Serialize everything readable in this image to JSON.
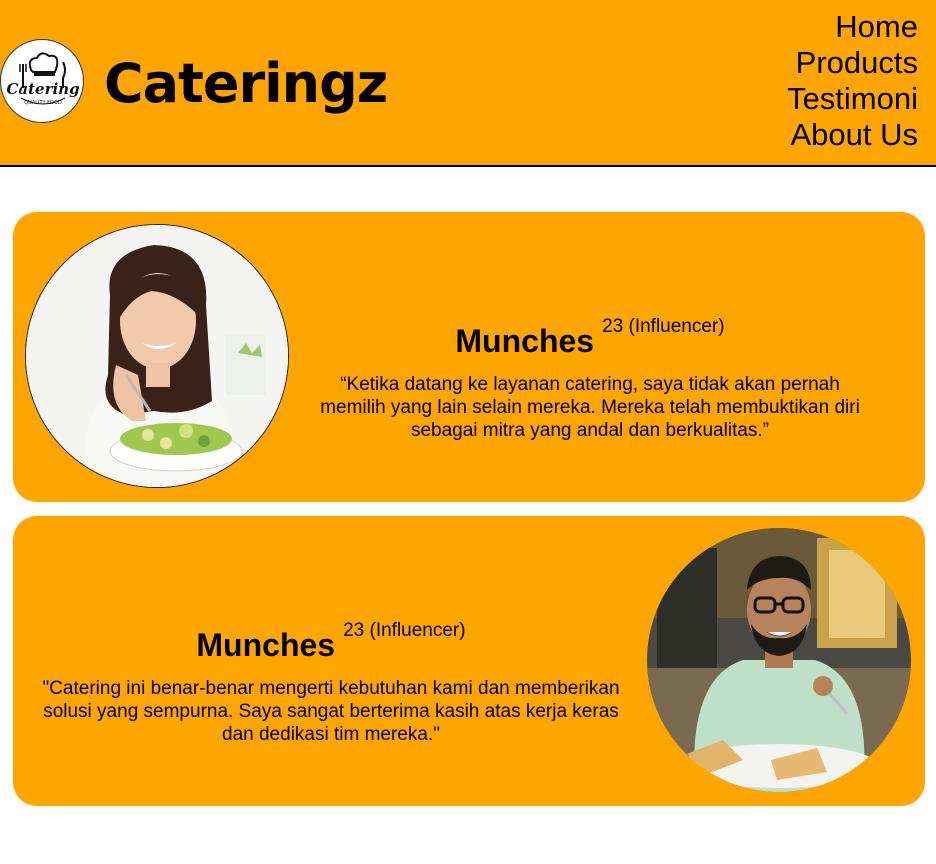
{
  "header": {
    "logo": {
      "text": "Catering",
      "subtext": "QUALITY FOOD",
      "icon": "chef-hat-icon"
    },
    "brand": "Cateringz",
    "nav": [
      {
        "label": "Home"
      },
      {
        "label": "Products"
      },
      {
        "label": "Testimoni"
      },
      {
        "label": "About Us"
      }
    ]
  },
  "testimonials": [
    {
      "name": "Munches",
      "meta": "23 (Influencer)",
      "quote": "“Ketika datang ke layanan catering, saya tidak akan pernah memilih yang lain selain mereka. Mereka telah membuktikan diri sebagai mitra yang andal dan berkualitas.”",
      "photo": "woman-eating-salad"
    },
    {
      "name": "Munches",
      "meta": "23 (Influencer)",
      "quote": "\"Catering ini benar-benar mengerti kebutuhan kami dan memberikan solusi yang sempurna. Saya sangat berterima kasih atas kerja keras dan dedikasi tim mereka.\"",
      "photo": "man-eating-pizza"
    }
  ],
  "colors": {
    "primary": "#ffa500",
    "text": "#000000",
    "background": "#ffffff"
  }
}
